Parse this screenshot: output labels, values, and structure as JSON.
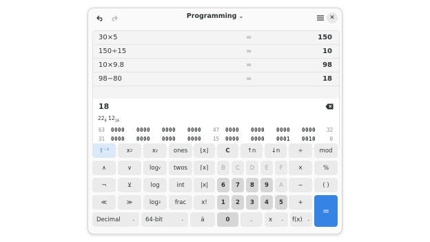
{
  "header": {
    "undo_icon": "undo-icon",
    "redo_icon": "redo-icon",
    "title": "Programming",
    "title_chevron": "⌄",
    "menu_icon": "hamburger-icon",
    "close_glyph": "✕"
  },
  "history": [
    {
      "expr": "30×5",
      "eq": "=",
      "result": "150"
    },
    {
      "expr": "150÷15",
      "eq": "=",
      "result": "10"
    },
    {
      "expr": "10×9.8",
      "eq": "=",
      "result": "98"
    },
    {
      "expr": "98−80",
      "eq": "=",
      "result": "18"
    }
  ],
  "current": {
    "value": "18"
  },
  "radix": {
    "octal_value": "22",
    "octal_base": "8",
    "hex_value": "12",
    "hex_base": "16"
  },
  "bits": {
    "row1": {
      "left_index": "63",
      "mid_index": "47",
      "right_index": "32",
      "groups": [
        "0000",
        "0000",
        "0000",
        "0000",
        "0000",
        "0000",
        "0000",
        "0000"
      ]
    },
    "row2": {
      "left_index": "31",
      "mid_index": "15",
      "right_index": "0",
      "groups": [
        "0000",
        "0000",
        "0000",
        "0000",
        "0000",
        "0000",
        "0001",
        "0010"
      ]
    }
  },
  "keys": {
    "shift": "⇧⁻¹",
    "pow2_base": "x",
    "pow2_exp": "2",
    "powy_base": "x",
    "powy_exp": "y",
    "ones": "ones",
    "floor": "⌊x⌋",
    "clear": "C",
    "shl": "↑n",
    "shr": "↓n",
    "divide": "÷",
    "mod": "mod",
    "and": "∧",
    "or": "∨",
    "logy_base": "log",
    "logy_sub": "y",
    "twos": "twos",
    "ceil": "⌈x⌉",
    "hexB": "B",
    "hexC": "C",
    "hexD": "D",
    "hexE": "E",
    "hexF": "F",
    "multiply": "×",
    "percent": "%",
    "not": "¬",
    "xor": "⊻",
    "log": "log",
    "int": "int",
    "abs": "|x|",
    "d6": "6",
    "d7": "7",
    "d8": "8",
    "d9": "9",
    "hexA": "A",
    "minus": "−",
    "parens": "( )",
    "rol": "≪",
    "ror": "≫",
    "log2_base": "log",
    "log2_sub": "2",
    "frac": "frac",
    "fact": "x!",
    "d1": "1",
    "d2": "2",
    "d3": "3",
    "d4": "4",
    "d5": "5",
    "plus": "+",
    "equals": "=",
    "base_select": "Decimal",
    "word_select": "64-bit",
    "char": "á",
    "d0": "0",
    "point": ".",
    "var_select": "x",
    "func_select": "f(x)",
    "dd_arrow": "⌄"
  }
}
